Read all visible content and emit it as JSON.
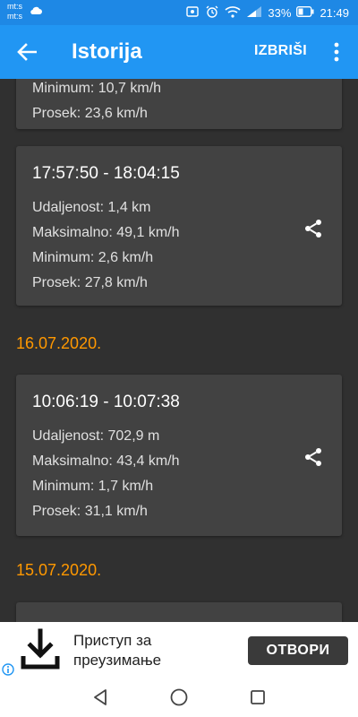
{
  "status_bar": {
    "carrier_1": "mt:s",
    "carrier_2": "mt:s",
    "battery": "33%",
    "time": "21:49"
  },
  "app_bar": {
    "title": "Istorija",
    "action_label": "IZBRIŠI"
  },
  "partial_card": {
    "lines": [
      "Minimum: 10,7 km/h",
      "Prosek: 23,6 km/h"
    ]
  },
  "cards": [
    {
      "time": "17:57:50 - 18:04:15",
      "distance": "Udaljenost: 1,4 km",
      "max": "Maksimalno: 49,1 km/h",
      "min": "Minimum: 2,6 km/h",
      "avg": "Prosek: 27,8 km/h"
    },
    {
      "time": "10:06:19 - 10:07:38",
      "distance": "Udaljenost: 702,9 m",
      "max": "Maksimalno: 43,4 km/h",
      "min": "Minimum: 1,7 km/h",
      "avg": "Prosek: 31,1 km/h"
    }
  ],
  "dates": [
    "16.07.2020.",
    "15.07.2020."
  ],
  "ad": {
    "text_line_1": "Приступ за",
    "text_line_2": "преузимање",
    "button": "ОТВОРИ"
  },
  "colors": {
    "app_bar": "#2196f3",
    "status_bar": "#1e88e5",
    "background": "#303030",
    "card": "#424242",
    "date_accent": "#ff9800"
  }
}
